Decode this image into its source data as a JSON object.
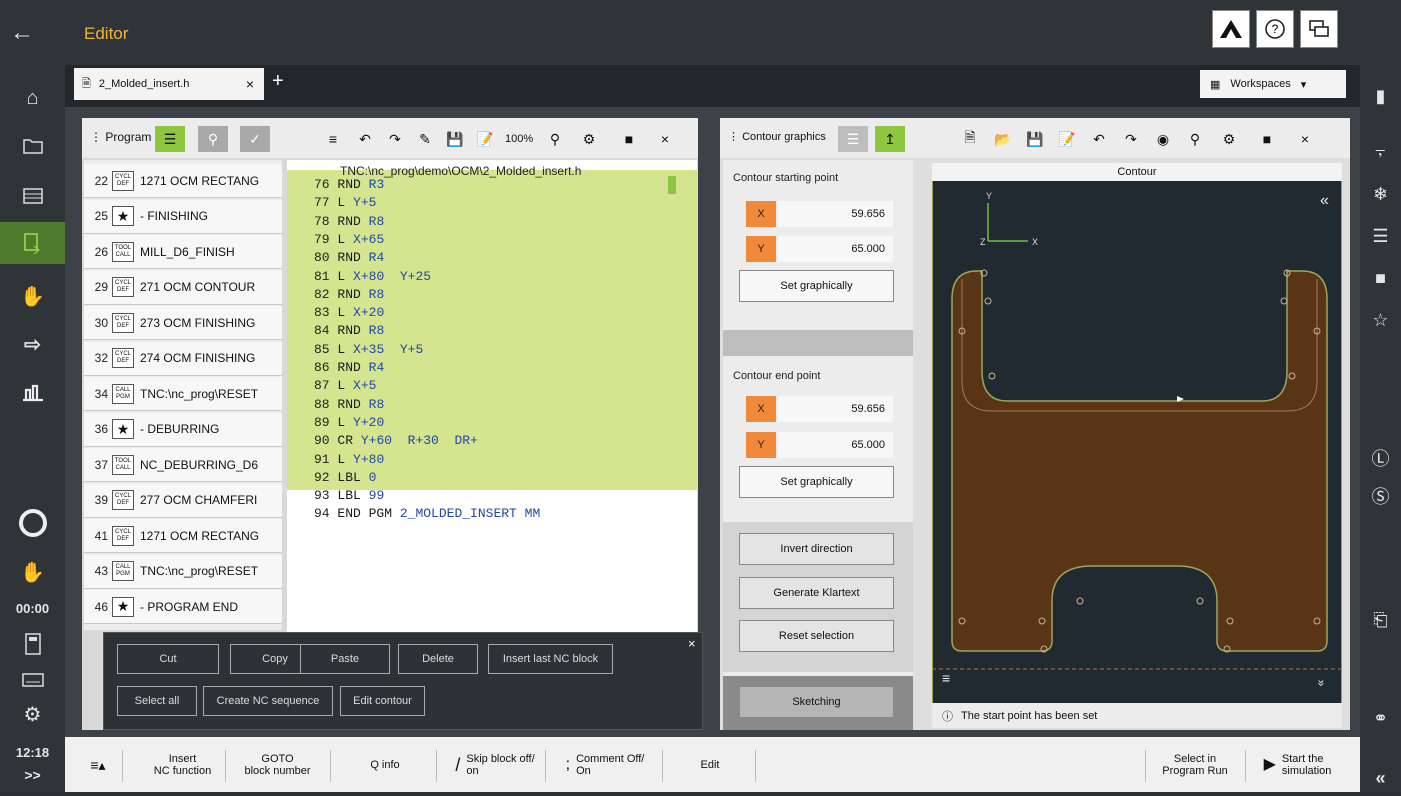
{
  "topbar": {
    "title": "Editor",
    "back_icon": "arrow-left-icon"
  },
  "tabs": [
    {
      "label": "2_Molded_insert.h",
      "close": "×"
    }
  ],
  "add_tab": "+",
  "workspaces": "Workspaces",
  "left_time": "00:00",
  "clock": "12:18",
  "expand": ">>",
  "program_panel": {
    "title": "Program",
    "zoom": "100%",
    "close": "×",
    "path": "TNC:\\nc_prog\\demo\\OCM\\2_Molded_insert.h",
    "blocks": [
      {
        "n": "22",
        "badge1": "CYCL",
        "badge2": "DEF",
        "text": "1271 OCM RECTANG"
      },
      {
        "n": "25",
        "star": "★",
        "text": "- FINISHING"
      },
      {
        "n": "26",
        "badge1": "TOOL",
        "badge2": "CALL",
        "text": "MILL_D6_FINISH"
      },
      {
        "n": "29",
        "badge1": "CYCL",
        "badge2": "DEF",
        "text": "271 OCM CONTOUR"
      },
      {
        "n": "30",
        "badge1": "CYCL",
        "badge2": "DEF",
        "text": "273 OCM FINISHING"
      },
      {
        "n": "32",
        "badge1": "CYCL",
        "badge2": "DEF",
        "text": "274 OCM FINISHING"
      },
      {
        "n": "34",
        "badge1": "CALL",
        "badge2": "PGM",
        "text": "TNC:\\nc_prog\\RESET"
      },
      {
        "n": "36",
        "star": "★",
        "text": "- DEBURRING"
      },
      {
        "n": "37",
        "badge1": "TOOL",
        "badge2": "CALL",
        "text": "NC_DEBURRING_D6"
      },
      {
        "n": "39",
        "badge1": "CYCL",
        "badge2": "DEF",
        "text": "277 OCM CHAMFERI"
      },
      {
        "n": "41",
        "badge1": "CYCL",
        "badge2": "DEF",
        "text": "1271 OCM RECTANG"
      },
      {
        "n": "43",
        "badge1": "CALL",
        "badge2": "PGM",
        "text": "TNC:\\nc_prog\\RESET"
      },
      {
        "n": "46",
        "star": "★",
        "text": "- PROGRAM END"
      }
    ],
    "code": [
      {
        "n": "76",
        "a": "RND",
        "b": "R3"
      },
      {
        "n": "77",
        "a": "L",
        "b": "Y+5"
      },
      {
        "n": "78",
        "a": "RND",
        "b": "R8"
      },
      {
        "n": "79",
        "a": "L",
        "b": "X+65"
      },
      {
        "n": "80",
        "a": "RND",
        "b": "R4"
      },
      {
        "n": "81",
        "a": "L",
        "b": "X+80  Y+25"
      },
      {
        "n": "82",
        "a": "RND",
        "b": "R8"
      },
      {
        "n": "83",
        "a": "L",
        "b": "X+20"
      },
      {
        "n": "84",
        "a": "RND",
        "b": "R8"
      },
      {
        "n": "85",
        "a": "L",
        "b": "X+35  Y+5"
      },
      {
        "n": "86",
        "a": "RND",
        "b": "R4"
      },
      {
        "n": "87",
        "a": "L",
        "b": "X+5"
      },
      {
        "n": "88",
        "a": "RND",
        "b": "R8"
      },
      {
        "n": "89",
        "a": "L",
        "b": "Y+20"
      },
      {
        "n": "90",
        "a": "CR",
        "b": "Y+60  R+30  DR+"
      },
      {
        "n": "91",
        "a": "L",
        "b": "Y+80"
      },
      {
        "n": "92",
        "a": "LBL",
        "b": "0"
      },
      {
        "n": "93",
        "a": "LBL",
        "b": "99"
      },
      {
        "n": "94",
        "a": "END PGM",
        "b": "2_MOLDED_INSERT MM"
      }
    ]
  },
  "edit_toolbar": {
    "buttons_row1": [
      "Cut",
      "Copy",
      "Paste",
      "Delete",
      "Insert last NC block"
    ],
    "buttons_row2": [
      "Select all",
      "Create NC sequence",
      "Edit contour"
    ],
    "close": "×"
  },
  "contour_panel": {
    "title": "Contour graphics",
    "close": "×",
    "start_label": "Contour starting point",
    "start_x_axis": "X",
    "start_x": "59.656",
    "start_y_axis": "Y",
    "start_y": "65.000",
    "set_graphically": "Set graphically",
    "end_label": "Contour end point",
    "end_x_axis": "X",
    "end_x": "59.656",
    "end_y_axis": "Y",
    "end_y": "65.000",
    "set_graphically2": "Set graphically",
    "invert": "Invert direction",
    "generate": "Generate Klartext",
    "reset": "Reset selection",
    "sketching": "Sketching",
    "view_title": "Contour",
    "axis_y": "Y",
    "axis_z": "Z",
    "axis_x": "X",
    "collapse": "«",
    "expand_down": "»",
    "message": "The start point has been set",
    "shape_color": "#5a3416",
    "outline_color": "#9aa85a"
  },
  "bottom": {
    "menu": "≡▴",
    "insert1": "Insert",
    "insert2": "NC function",
    "goto1": "GOTO",
    "goto2": "block number",
    "qinfo": "Q info",
    "skip1": "Skip block off/",
    "skip2": "on",
    "comment1": "Comment Off/",
    "comment2": "On",
    "edit": "Edit",
    "select1": "Select in",
    "select2": "Program Run",
    "start1": "Start the",
    "start2": "simulation",
    "collapse": "«"
  }
}
